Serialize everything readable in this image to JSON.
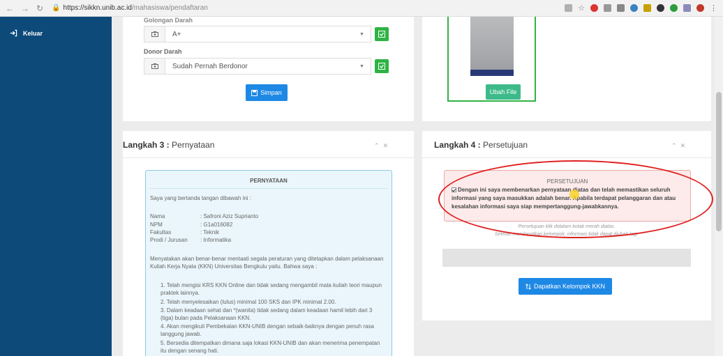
{
  "browser": {
    "url_host": "https://sikkn.unib.ac.id",
    "url_path": "/mahasiswa/pendaftaran"
  },
  "sidebar": {
    "items": [
      {
        "label": "Keluar",
        "icon": "sign-out-icon"
      }
    ]
  },
  "form": {
    "golongan_label": "Golongan Darah",
    "golongan_value": "A+",
    "donor_label": "Donor Darah",
    "donor_value": "Sudah Pernah Berdonor",
    "simpan_label": "Simpan"
  },
  "photo": {
    "ubah_label": "Ubah File"
  },
  "step3": {
    "title_bold": "Langkah 3 :",
    "title_rest": " Pernyataan",
    "box_title": "PERNYATAAN",
    "intro": "Saya yang bertanda tangan dibawah ini :",
    "fields": [
      {
        "key": "Nama",
        "value": ": Safroni Aziz Suprianto"
      },
      {
        "key": "NPM",
        "value": ": G1a016082"
      },
      {
        "key": "Fakultas",
        "value": ": Teknik"
      },
      {
        "key": "Prodi / Jurusan",
        "value": ": Informatika"
      }
    ],
    "statement": "Menyatakan akan benar-benar mentaati segala peraturan yang ditetapkan dalam pelaksanaan Kuliah Kerja Nyata (KKN) Universitas Bengkulu yaitu. Bahwa saya :",
    "items": [
      "1. Telah mengisi KRS KKN Online dan tidak sedang mengambil mata kuliah teori maupun praktek lainnya.",
      "2. Telah menyelesaikan (lulus) minimal 100 SKS dan IPK minimal 2.00.",
      "3. Dalam keadaan sehat dan *(wanita) tidak sedang dalam keadaan hamil lebih dari 3 (tiga) bulan pada Pelaksanaan KKN.",
      "4. Akan mengikuti Pembekalan KKN-UNIB dengan sebaik-baiknya dengan penuh rasa tanggung jawab.",
      "5. Bersedia ditempatkan dimana saja lokasi KKN-UNIB dan akan menerima penempatan itu dengan senang hati."
    ]
  },
  "step4": {
    "title_bold": "Langkah 4 :",
    "title_rest": " Persetujuan",
    "box_title": "PERSETUJUAN",
    "agreement_text": "Dengan ini saya membenarkan pernyataan diatas dan telah memastikan seluruh informasi yang saya masukkan adalah benar. Apabila terdapat pelanggaran dan atau kesalahan informasi saya siap mempertanggung-jawabkannya.",
    "agreement_checked": true,
    "hint1": "Persetujuan klik didalam kotak merah diatas.",
    "hint2": "Setelah mendapatkan kelompok, informasi tidak dapat diubah lagi.",
    "button_label": "Dapatkan Kelompok KKN"
  },
  "colors": {
    "sidebar": "#0d4a7a",
    "primary": "#1e88e5",
    "success": "#2fb344",
    "teal": "#3dba8a",
    "annotation": "#e02020"
  }
}
